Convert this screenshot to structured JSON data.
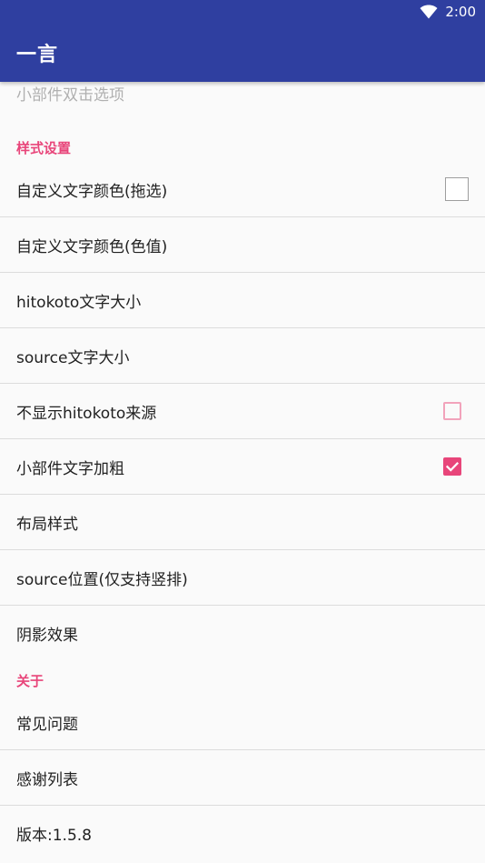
{
  "status_bar": {
    "time": "2:00",
    "wifi_icon": "wifi-icon"
  },
  "app_bar": {
    "title": "一言",
    "background": "#2f3fa0"
  },
  "accent_color": "#e8457a",
  "partial_item": {
    "label": "小部件双击选项"
  },
  "sections": [
    {
      "header": "样式设置",
      "items": [
        {
          "label": "自定义文字颜色(拖选)",
          "widget": "color-swatch"
        },
        {
          "label": "自定义文字颜色(色值)"
        },
        {
          "label": "hitokoto文字大小"
        },
        {
          "label": "source文字大小"
        },
        {
          "label": "不显示hitokoto来源",
          "widget": "checkbox",
          "checked": false
        },
        {
          "label": "小部件文字加粗",
          "widget": "checkbox",
          "checked": true
        },
        {
          "label": "布局样式"
        },
        {
          "label": "source位置(仅支持竖排)"
        },
        {
          "label": "阴影效果"
        }
      ]
    },
    {
      "header": "关于",
      "items": [
        {
          "label": "常见问题"
        },
        {
          "label": "感谢列表"
        },
        {
          "label": "版本:1.5.8"
        }
      ]
    }
  ]
}
